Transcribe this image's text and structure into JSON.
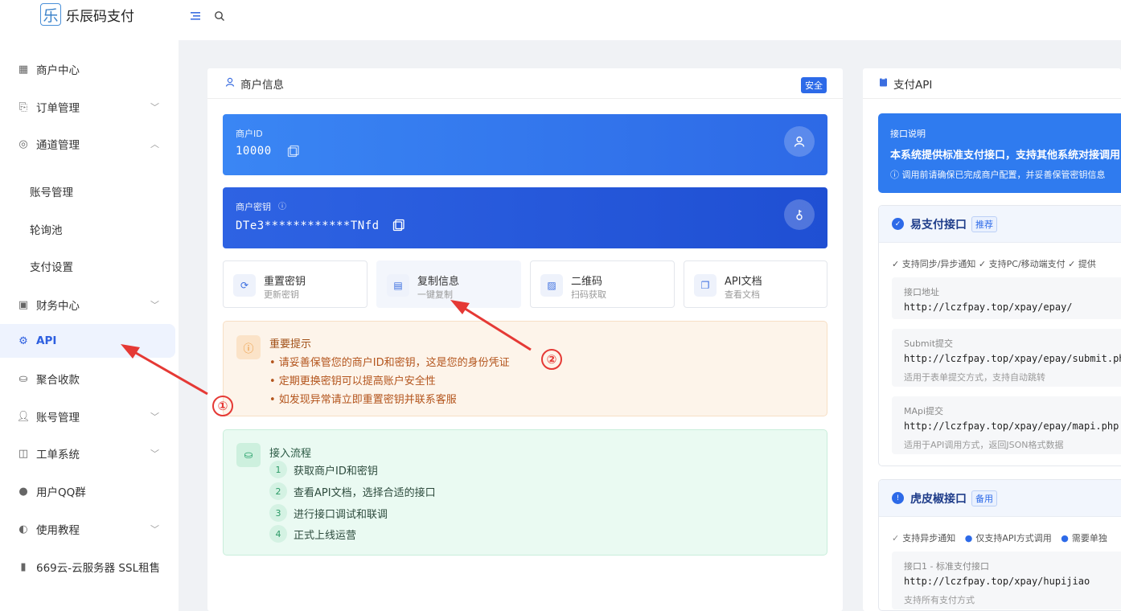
{
  "header": {
    "logo_char": "乐",
    "title": "乐辰码支付"
  },
  "sidebar": {
    "items": [
      {
        "label": "商户中心"
      },
      {
        "label": "订单管理"
      },
      {
        "label": "通道管理"
      },
      {
        "label": "账号管理"
      },
      {
        "label": "轮询池"
      },
      {
        "label": "支付设置"
      },
      {
        "label": "财务中心"
      },
      {
        "label": "API"
      },
      {
        "label": "聚合收款"
      },
      {
        "label": "账号管理"
      },
      {
        "label": "工单系统"
      },
      {
        "label": "用户QQ群"
      },
      {
        "label": "使用教程"
      },
      {
        "label": "669云-云服务器 SSL租售"
      }
    ]
  },
  "merchant": {
    "title": "商户信息",
    "badge": "安全",
    "id_label": "商户ID",
    "id_value": "10000",
    "key_label": "商户密钥",
    "key_value": "DTe3************TNfd",
    "actions": [
      {
        "title": "重置密钥",
        "sub": "更新密钥"
      },
      {
        "title": "复制信息",
        "sub": "一键复制"
      },
      {
        "title": "二维码",
        "sub": "扫码获取"
      },
      {
        "title": "API文档",
        "sub": "查看文档"
      }
    ],
    "notice": {
      "title": "重要提示",
      "lines": [
        "• 请妥善保管您的商户ID和密钥，这是您的身份凭证",
        "• 定期更换密钥可以提高账户安全性",
        "• 如发现异常请立即重置密钥并联系客服"
      ]
    },
    "flow": {
      "title": "接入流程",
      "steps": [
        {
          "n": "1",
          "text": "获取商户ID和密钥"
        },
        {
          "n": "2",
          "text": "查看API文档，选择合适的接口"
        },
        {
          "n": "3",
          "text": "进行接口调试和联调"
        },
        {
          "n": "4",
          "text": "正式上线运营"
        }
      ]
    }
  },
  "api": {
    "title": "支付API",
    "note": {
      "label": "接口说明",
      "text": "本系统提供标准支付接口，支持其他系统对接调用",
      "tip": "ⓘ 调用前请确保已完成商户配置，并妥善保管密钥信息"
    },
    "epay": {
      "name": "易支付接口",
      "tag": "推荐",
      "features": "✓ 支持同步/异步通知   ✓ 支持PC/移动端支付   ✓ 提供",
      "endpoints": [
        {
          "label": "接口地址",
          "url": "http://lczfpay.top/xpay/epay/",
          "desc": ""
        },
        {
          "label": "Submit提交",
          "url": "http://lczfpay.top/xpay/epay/submit.php",
          "desc": "适用于表单提交方式，支持自动跳转"
        },
        {
          "label": "MApi提交",
          "url": "http://lczfpay.top/xpay/epay/mapi.php",
          "desc": "适用于API调用方式，返回JSON格式数据"
        }
      ]
    },
    "hupi": {
      "name": "虎皮椒接口",
      "tag": "备用",
      "f1": "支持异步通知",
      "f2": "仅支持API方式调用",
      "f3": "需要单独",
      "endpoint": {
        "label": "接口1 - 标准支付接口",
        "url": "http://lczfpay.top/xpay/hupijiao",
        "desc": "支持所有支付方式"
      }
    }
  },
  "annotations": {
    "a1": "①",
    "a2": "②"
  },
  "colors": {
    "accent": "#2d6ae8",
    "arrow": "#e53935"
  }
}
